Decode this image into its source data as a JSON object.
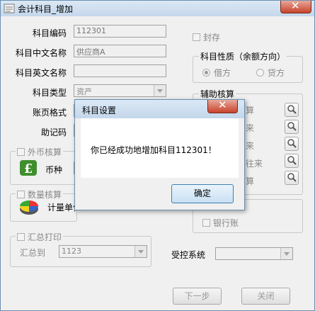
{
  "window": {
    "title": "会计科目_增加"
  },
  "form": {
    "code_label": "科目编码",
    "code_value": "112301",
    "cn_name_label": "科目中文名称",
    "cn_name_value": "供应商A",
    "en_name_label": "科目英文名称",
    "en_name_value": "",
    "type_label": "科目类型",
    "type_value": "资产",
    "page_format_label": "账页格式",
    "mnemonic_label": "助记码"
  },
  "seal": {
    "label": "封存"
  },
  "nature": {
    "title": "科目性质（余额方向）",
    "debit": "借方",
    "credit": "贷方"
  },
  "aux": {
    "title": "辅助核算",
    "partial_texts": [
      "算",
      "来",
      "来",
      "往来",
      "算"
    ]
  },
  "foreign": {
    "title": "外币核算",
    "currency_label": "币种"
  },
  "quantity": {
    "title": "数量核算",
    "unit_label": "计量单位"
  },
  "bank": {
    "label": "银行账"
  },
  "summary": {
    "title": "汇总打印",
    "to_label": "汇总到",
    "to_value": "1123"
  },
  "controlled": {
    "label": "受控系统"
  },
  "buttons": {
    "next": "下一步",
    "close": "关闭"
  },
  "dialog": {
    "title": "科目设置",
    "message": "你已经成功地增加科目112301！",
    "ok": "确定"
  },
  "colors": {
    "accent": "#3c7fb1",
    "close_red": "#c7432b"
  }
}
